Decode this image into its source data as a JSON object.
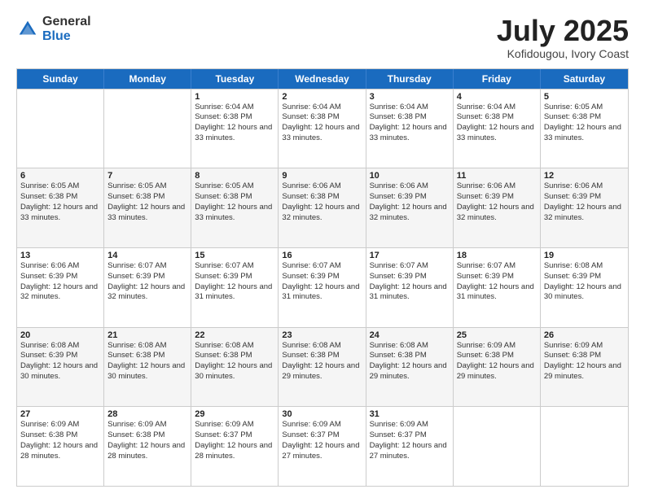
{
  "logo": {
    "general": "General",
    "blue": "Blue"
  },
  "title": {
    "month_year": "July 2025",
    "location": "Kofidougou, Ivory Coast"
  },
  "header_days": [
    "Sunday",
    "Monday",
    "Tuesday",
    "Wednesday",
    "Thursday",
    "Friday",
    "Saturday"
  ],
  "weeks": [
    {
      "alt": false,
      "cells": [
        {
          "day": "",
          "sunrise": "",
          "sunset": "",
          "daylight": ""
        },
        {
          "day": "",
          "sunrise": "",
          "sunset": "",
          "daylight": ""
        },
        {
          "day": "1",
          "sunrise": "Sunrise: 6:04 AM",
          "sunset": "Sunset: 6:38 PM",
          "daylight": "Daylight: 12 hours and 33 minutes."
        },
        {
          "day": "2",
          "sunrise": "Sunrise: 6:04 AM",
          "sunset": "Sunset: 6:38 PM",
          "daylight": "Daylight: 12 hours and 33 minutes."
        },
        {
          "day": "3",
          "sunrise": "Sunrise: 6:04 AM",
          "sunset": "Sunset: 6:38 PM",
          "daylight": "Daylight: 12 hours and 33 minutes."
        },
        {
          "day": "4",
          "sunrise": "Sunrise: 6:04 AM",
          "sunset": "Sunset: 6:38 PM",
          "daylight": "Daylight: 12 hours and 33 minutes."
        },
        {
          "day": "5",
          "sunrise": "Sunrise: 6:05 AM",
          "sunset": "Sunset: 6:38 PM",
          "daylight": "Daylight: 12 hours and 33 minutes."
        }
      ]
    },
    {
      "alt": true,
      "cells": [
        {
          "day": "6",
          "sunrise": "Sunrise: 6:05 AM",
          "sunset": "Sunset: 6:38 PM",
          "daylight": "Daylight: 12 hours and 33 minutes."
        },
        {
          "day": "7",
          "sunrise": "Sunrise: 6:05 AM",
          "sunset": "Sunset: 6:38 PM",
          "daylight": "Daylight: 12 hours and 33 minutes."
        },
        {
          "day": "8",
          "sunrise": "Sunrise: 6:05 AM",
          "sunset": "Sunset: 6:38 PM",
          "daylight": "Daylight: 12 hours and 33 minutes."
        },
        {
          "day": "9",
          "sunrise": "Sunrise: 6:06 AM",
          "sunset": "Sunset: 6:38 PM",
          "daylight": "Daylight: 12 hours and 32 minutes."
        },
        {
          "day": "10",
          "sunrise": "Sunrise: 6:06 AM",
          "sunset": "Sunset: 6:39 PM",
          "daylight": "Daylight: 12 hours and 32 minutes."
        },
        {
          "day": "11",
          "sunrise": "Sunrise: 6:06 AM",
          "sunset": "Sunset: 6:39 PM",
          "daylight": "Daylight: 12 hours and 32 minutes."
        },
        {
          "day": "12",
          "sunrise": "Sunrise: 6:06 AM",
          "sunset": "Sunset: 6:39 PM",
          "daylight": "Daylight: 12 hours and 32 minutes."
        }
      ]
    },
    {
      "alt": false,
      "cells": [
        {
          "day": "13",
          "sunrise": "Sunrise: 6:06 AM",
          "sunset": "Sunset: 6:39 PM",
          "daylight": "Daylight: 12 hours and 32 minutes."
        },
        {
          "day": "14",
          "sunrise": "Sunrise: 6:07 AM",
          "sunset": "Sunset: 6:39 PM",
          "daylight": "Daylight: 12 hours and 32 minutes."
        },
        {
          "day": "15",
          "sunrise": "Sunrise: 6:07 AM",
          "sunset": "Sunset: 6:39 PM",
          "daylight": "Daylight: 12 hours and 31 minutes."
        },
        {
          "day": "16",
          "sunrise": "Sunrise: 6:07 AM",
          "sunset": "Sunset: 6:39 PM",
          "daylight": "Daylight: 12 hours and 31 minutes."
        },
        {
          "day": "17",
          "sunrise": "Sunrise: 6:07 AM",
          "sunset": "Sunset: 6:39 PM",
          "daylight": "Daylight: 12 hours and 31 minutes."
        },
        {
          "day": "18",
          "sunrise": "Sunrise: 6:07 AM",
          "sunset": "Sunset: 6:39 PM",
          "daylight": "Daylight: 12 hours and 31 minutes."
        },
        {
          "day": "19",
          "sunrise": "Sunrise: 6:08 AM",
          "sunset": "Sunset: 6:39 PM",
          "daylight": "Daylight: 12 hours and 30 minutes."
        }
      ]
    },
    {
      "alt": true,
      "cells": [
        {
          "day": "20",
          "sunrise": "Sunrise: 6:08 AM",
          "sunset": "Sunset: 6:39 PM",
          "daylight": "Daylight: 12 hours and 30 minutes."
        },
        {
          "day": "21",
          "sunrise": "Sunrise: 6:08 AM",
          "sunset": "Sunset: 6:38 PM",
          "daylight": "Daylight: 12 hours and 30 minutes."
        },
        {
          "day": "22",
          "sunrise": "Sunrise: 6:08 AM",
          "sunset": "Sunset: 6:38 PM",
          "daylight": "Daylight: 12 hours and 30 minutes."
        },
        {
          "day": "23",
          "sunrise": "Sunrise: 6:08 AM",
          "sunset": "Sunset: 6:38 PM",
          "daylight": "Daylight: 12 hours and 29 minutes."
        },
        {
          "day": "24",
          "sunrise": "Sunrise: 6:08 AM",
          "sunset": "Sunset: 6:38 PM",
          "daylight": "Daylight: 12 hours and 29 minutes."
        },
        {
          "day": "25",
          "sunrise": "Sunrise: 6:09 AM",
          "sunset": "Sunset: 6:38 PM",
          "daylight": "Daylight: 12 hours and 29 minutes."
        },
        {
          "day": "26",
          "sunrise": "Sunrise: 6:09 AM",
          "sunset": "Sunset: 6:38 PM",
          "daylight": "Daylight: 12 hours and 29 minutes."
        }
      ]
    },
    {
      "alt": false,
      "cells": [
        {
          "day": "27",
          "sunrise": "Sunrise: 6:09 AM",
          "sunset": "Sunset: 6:38 PM",
          "daylight": "Daylight: 12 hours and 28 minutes."
        },
        {
          "day": "28",
          "sunrise": "Sunrise: 6:09 AM",
          "sunset": "Sunset: 6:38 PM",
          "daylight": "Daylight: 12 hours and 28 minutes."
        },
        {
          "day": "29",
          "sunrise": "Sunrise: 6:09 AM",
          "sunset": "Sunset: 6:37 PM",
          "daylight": "Daylight: 12 hours and 28 minutes."
        },
        {
          "day": "30",
          "sunrise": "Sunrise: 6:09 AM",
          "sunset": "Sunset: 6:37 PM",
          "daylight": "Daylight: 12 hours and 27 minutes."
        },
        {
          "day": "31",
          "sunrise": "Sunrise: 6:09 AM",
          "sunset": "Sunset: 6:37 PM",
          "daylight": "Daylight: 12 hours and 27 minutes."
        },
        {
          "day": "",
          "sunrise": "",
          "sunset": "",
          "daylight": ""
        },
        {
          "day": "",
          "sunrise": "",
          "sunset": "",
          "daylight": ""
        }
      ]
    }
  ]
}
